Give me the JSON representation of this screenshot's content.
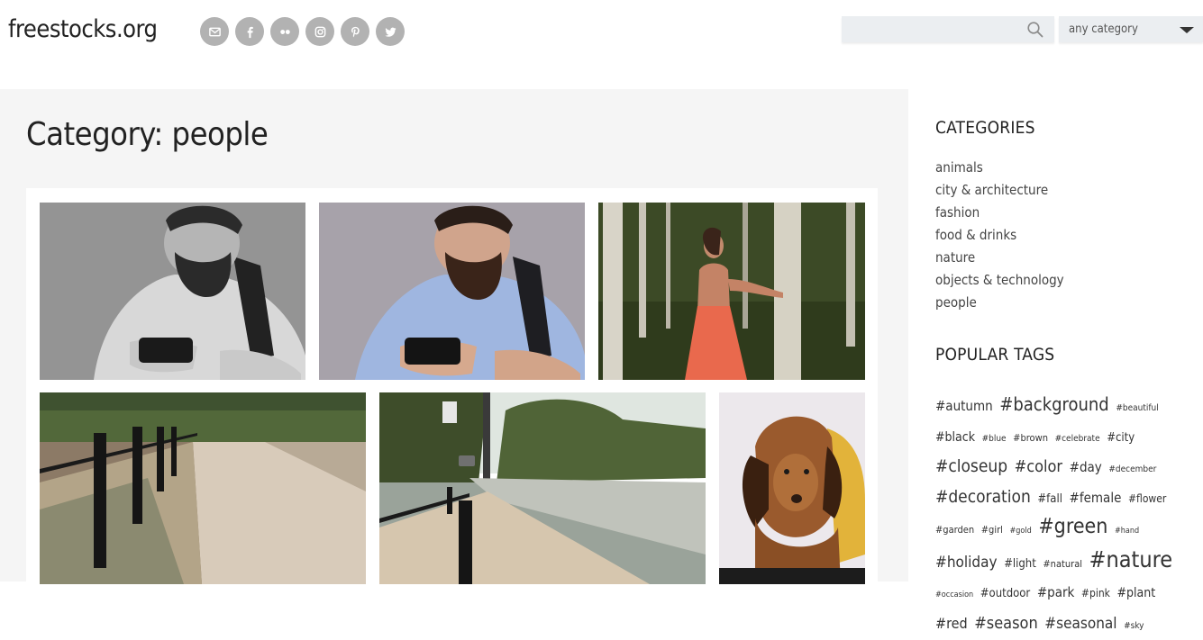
{
  "site": {
    "logo": "freestocks.org"
  },
  "social": [
    "mail-icon",
    "facebook-icon",
    "flickr-icon",
    "instagram-icon",
    "pinterest-icon",
    "twitter-icon"
  ],
  "search": {
    "placeholder": "",
    "value": ""
  },
  "category_select": {
    "value": "any category"
  },
  "page": {
    "title": "Category: people"
  },
  "photos": [
    {
      "subject": "bearded man with camera, black and white"
    },
    {
      "subject": "bearded man with camera, color"
    },
    {
      "subject": "woman in coral dress in birch forest"
    },
    {
      "subject": "sidewalk with bollards at sunrise"
    },
    {
      "subject": "street and sidewalk at sunrise"
    },
    {
      "subject": "brown spaniel puppy"
    }
  ],
  "sidebar": {
    "categories_heading": "CATEGORIES",
    "categories": [
      "animals",
      "city & architecture",
      "fashion",
      "food & drinks",
      "nature",
      "objects & technology",
      "people"
    ],
    "tags_heading": "POPULAR TAGS",
    "tags": [
      {
        "label": "#autumn",
        "size": 15
      },
      {
        "label": "#background",
        "size": 20
      },
      {
        "label": "#beautiful",
        "size": 10
      },
      {
        "label": "#black",
        "size": 14
      },
      {
        "label": "#blue",
        "size": 10
      },
      {
        "label": "#brown",
        "size": 11
      },
      {
        "label": "#celebrate",
        "size": 10
      },
      {
        "label": "#city",
        "size": 13
      },
      {
        "label": "#closeup",
        "size": 19
      },
      {
        "label": "#color",
        "size": 18
      },
      {
        "label": "#day",
        "size": 15
      },
      {
        "label": "#december",
        "size": 10
      },
      {
        "label": "#decoration",
        "size": 19
      },
      {
        "label": "#fall",
        "size": 13
      },
      {
        "label": "#female",
        "size": 15
      },
      {
        "label": "#flower",
        "size": 12
      },
      {
        "label": "#garden",
        "size": 11
      },
      {
        "label": "#girl",
        "size": 11
      },
      {
        "label": "#gold",
        "size": 9
      },
      {
        "label": "#green",
        "size": 23
      },
      {
        "label": "#hand",
        "size": 9
      },
      {
        "label": "#holiday",
        "size": 17
      },
      {
        "label": "#light",
        "size": 13
      },
      {
        "label": "#natural",
        "size": 11
      },
      {
        "label": "#nature",
        "size": 25
      },
      {
        "label": "#occasion",
        "size": 9
      },
      {
        "label": "#outdoor",
        "size": 13
      },
      {
        "label": "#park",
        "size": 15
      },
      {
        "label": "#pink",
        "size": 12
      },
      {
        "label": "#plant",
        "size": 14
      },
      {
        "label": "#red",
        "size": 16
      },
      {
        "label": "#season",
        "size": 18
      },
      {
        "label": "#seasonal",
        "size": 17
      },
      {
        "label": "#sky",
        "size": 10
      }
    ]
  }
}
